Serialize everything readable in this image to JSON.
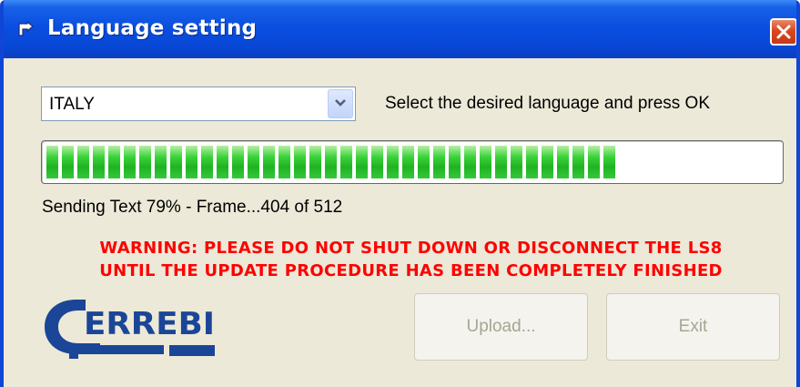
{
  "window": {
    "title": "Language setting"
  },
  "language": {
    "selected": "ITALY",
    "instruction": "Select the desired language and press OK"
  },
  "progress": {
    "percent": 79,
    "status": "Sending Text 79% - Frame...404 of 512"
  },
  "warning": {
    "line1": "WARNING: PLEASE DO NOT SHUT DOWN OR DISCONNECT THE LS8",
    "line2": "UNTIL THE UPDATE PROCEDURE HAS BEEN COMPLETELY FINISHED"
  },
  "logo": {
    "text": "ERREBI"
  },
  "buttons": {
    "upload": "Upload...",
    "exit": "Exit"
  },
  "colors": {
    "titlebar": "#0a4fe0",
    "progress_green": "#20b222",
    "warning_red": "#ff0000",
    "logo_blue": "#1b4597"
  },
  "icons": {
    "title": "window-icon",
    "close": "close-icon",
    "dropdown": "chevron-down-icon"
  }
}
